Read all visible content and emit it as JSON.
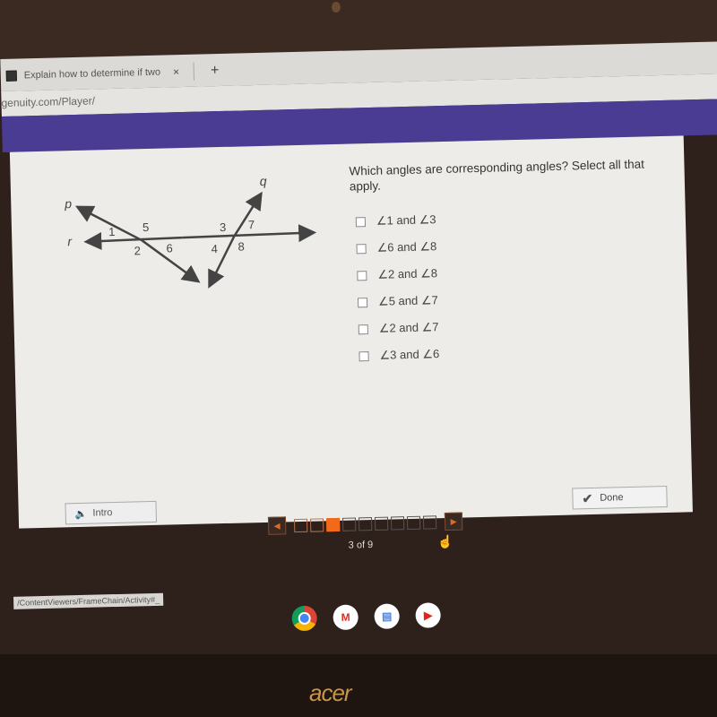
{
  "browser": {
    "tab_title": "Explain how to determine if two",
    "tab_close": "×",
    "new_tab": "+",
    "url": "genuity.com/Player/",
    "status_url": "/ContentViewers/FrameChain/Activity#_"
  },
  "diagram": {
    "line_labels": {
      "p": "p",
      "q": "q",
      "r": "r"
    },
    "angle_labels": [
      "1",
      "2",
      "3",
      "4",
      "5",
      "6",
      "7",
      "8"
    ]
  },
  "question": {
    "prompt": "Which angles are corresponding angles? Select all that apply.",
    "options": [
      {
        "label": "∠1 and ∠3",
        "checked": false
      },
      {
        "label": "∠6 and ∠8",
        "checked": false
      },
      {
        "label": "∠2 and ∠8",
        "checked": false
      },
      {
        "label": "∠5 and ∠7",
        "checked": false
      },
      {
        "label": "∠2 and ∠7",
        "checked": false
      },
      {
        "label": "∠3 and ∠6",
        "checked": false
      }
    ]
  },
  "buttons": {
    "intro": "Intro",
    "intro_icon": "speaker-icon",
    "done": "Done",
    "done_icon": "check-icon"
  },
  "pager": {
    "current": 3,
    "total": 9,
    "label": "3 of 9",
    "accent": "#f06a1a"
  },
  "shelf": {
    "apps": [
      "Chrome",
      "Gmail",
      "Docs",
      "YouTube"
    ]
  },
  "device": {
    "brand": "acer"
  },
  "colors": {
    "header_band": "#4b3c93",
    "pager_accent": "#f06a1a"
  }
}
